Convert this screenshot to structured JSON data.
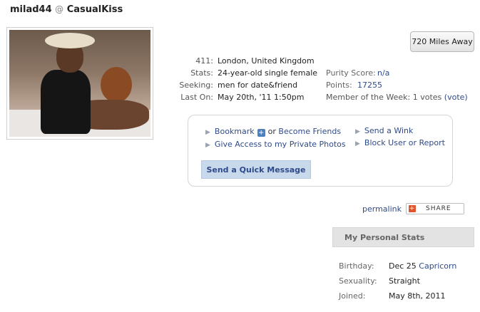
{
  "header": {
    "username": "milad44",
    "at": "@",
    "site": "CasualKiss"
  },
  "distance_button": "720 Miles Away",
  "profile_info": [
    {
      "label": "411:",
      "value": "London, United Kingdom"
    },
    {
      "label": "Stats:",
      "value": "24-year-old single female"
    },
    {
      "label": "Seeking:",
      "value": "men for date&friend"
    },
    {
      "label": "Last On:",
      "value": "May 20th, '11 1:50pm"
    }
  ],
  "scores": {
    "purity_label": "Purity Score:",
    "purity_value": "n/a",
    "points_label": "Points:",
    "points_value": "17255",
    "motw_label": "Member of the Week:",
    "motw_value": "1 votes",
    "vote_link": "vote"
  },
  "actions": {
    "bookmark": "Bookmark",
    "or_text": "or",
    "become_friends": "Become Friends",
    "private_photos": "Give Access to my Private Photos",
    "send_wink": "Send a Wink",
    "block_user": "Block User",
    "or_text2": "or",
    "report": "Report",
    "quick_message": "Send a Quick Message"
  },
  "permalink": "permalink",
  "share": "SHARE",
  "personal_stats": {
    "title": "My Personal Stats",
    "birthday_label": "Birthday:",
    "birthday_value": "Dec 25",
    "zodiac": "Capricorn",
    "sexuality_label": "Sexuality:",
    "sexuality_value": "Straight",
    "joined_label": "Joined:",
    "joined_value": "May 8th, 2011"
  },
  "colors": {
    "link": "#2f4a8a",
    "button_bg": "#c9d9ec",
    "share_icon": "#e0532e"
  },
  "icons": {
    "plus": "plus-icon",
    "share": "share-icon",
    "bullet": "triangle-bullet-icon"
  }
}
